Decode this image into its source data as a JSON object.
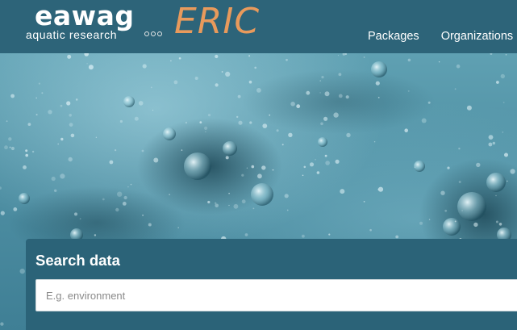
{
  "header": {
    "logo": {
      "word": "eawag",
      "subtitle": "aquatic research",
      "product": "ERIC"
    },
    "nav": [
      {
        "label": "Packages"
      },
      {
        "label": "Organizations"
      }
    ]
  },
  "hero": {
    "image": "underwater-bubbles"
  },
  "search": {
    "title": "Search data",
    "placeholder": "E.g. environment",
    "value": ""
  },
  "colors": {
    "header_bg": "#2d6479",
    "panel_bg": "#2b6378",
    "logo_accent": "#e89a5c",
    "text_light": "#ffffff"
  }
}
